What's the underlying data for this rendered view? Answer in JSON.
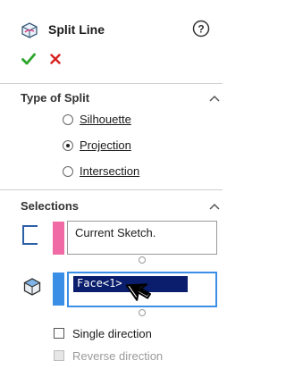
{
  "feature": {
    "title": "Split Line",
    "icon": "split-line-icon",
    "help_icon": "help-icon",
    "ok_icon": "check-icon",
    "cancel_icon": "close-icon"
  },
  "type_of_split": {
    "title": "Type of Split",
    "options": [
      {
        "label": "Silhouette",
        "selected": false
      },
      {
        "label": "Projection",
        "selected": true
      },
      {
        "label": "Intersection",
        "selected": false
      }
    ]
  },
  "selections": {
    "title": "Selections",
    "sketch_field": {
      "value": "Current Sketch.",
      "color": "#f06aa6",
      "icon": "sketch-icon"
    },
    "face_field": {
      "value": "Face<1>",
      "color": "#3a8ee6",
      "icon": "face-icon"
    }
  },
  "options": [
    {
      "label": "Single direction",
      "checked": false,
      "enabled": true
    },
    {
      "label": "Reverse direction",
      "checked": false,
      "enabled": false
    }
  ]
}
